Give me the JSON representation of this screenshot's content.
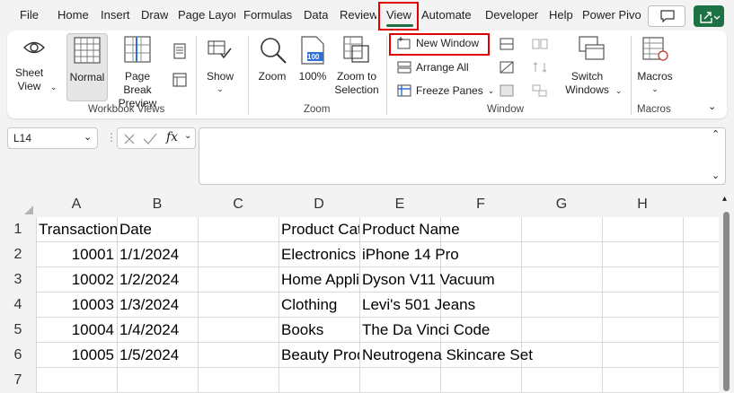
{
  "tabs": [
    "File",
    "Home",
    "Insert",
    "Draw",
    "Page Layout",
    "Formulas",
    "Data",
    "Review",
    "View",
    "Automate",
    "Developer",
    "Help",
    "Power Pivot"
  ],
  "active_tab": "View",
  "ribbon": {
    "workbook_views": {
      "label": "Workbook Views",
      "sheet_view": "Sheet View",
      "normal": "Normal",
      "page_break_preview": "Page Break Preview"
    },
    "show": {
      "label": "Show"
    },
    "zoom": {
      "label": "Zoom",
      "zoom": "Zoom",
      "hundred": "100%",
      "zoom_to_selection": "Zoom to Selection",
      "icon_text": "100"
    },
    "window": {
      "label": "Window",
      "new_window": "New Window",
      "arrange_all": "Arrange All",
      "freeze_panes": "Freeze Panes",
      "switch_windows": "Switch Windows"
    },
    "macros": {
      "label": "Macros",
      "macros": "Macros"
    }
  },
  "formula_bar": {
    "name_box": "L14",
    "fx": "fx",
    "formula": ""
  },
  "columns": [
    "A",
    "B",
    "C",
    "D",
    "E",
    "F",
    "G",
    "H"
  ],
  "rows": [
    "1",
    "2",
    "3",
    "4",
    "5",
    "6",
    "7"
  ],
  "sheet": {
    "row1": {
      "A": "Transaction ID",
      "B": "Date",
      "D": "Product Category",
      "E": "Product Name"
    },
    "data": [
      {
        "A": "10001",
        "B": "1/1/2024",
        "D": "Electronics",
        "E": "iPhone 14 Pro"
      },
      {
        "A": "10002",
        "B": "1/2/2024",
        "D": "Home Appliances",
        "E": "Dyson V11 Vacuum"
      },
      {
        "A": "10003",
        "B": "1/3/2024",
        "D": "Clothing",
        "E": "Levi's 501 Jeans"
      },
      {
        "A": "10004",
        "B": "1/4/2024",
        "D": "Books",
        "E": "The Da Vinci Code"
      },
      {
        "A": "10005",
        "B": "1/5/2024",
        "D": "Beauty Products",
        "E": "Neutrogena Skincare Set"
      }
    ]
  },
  "colors": {
    "accent": "#1e7145",
    "highlight": "#e00000"
  }
}
